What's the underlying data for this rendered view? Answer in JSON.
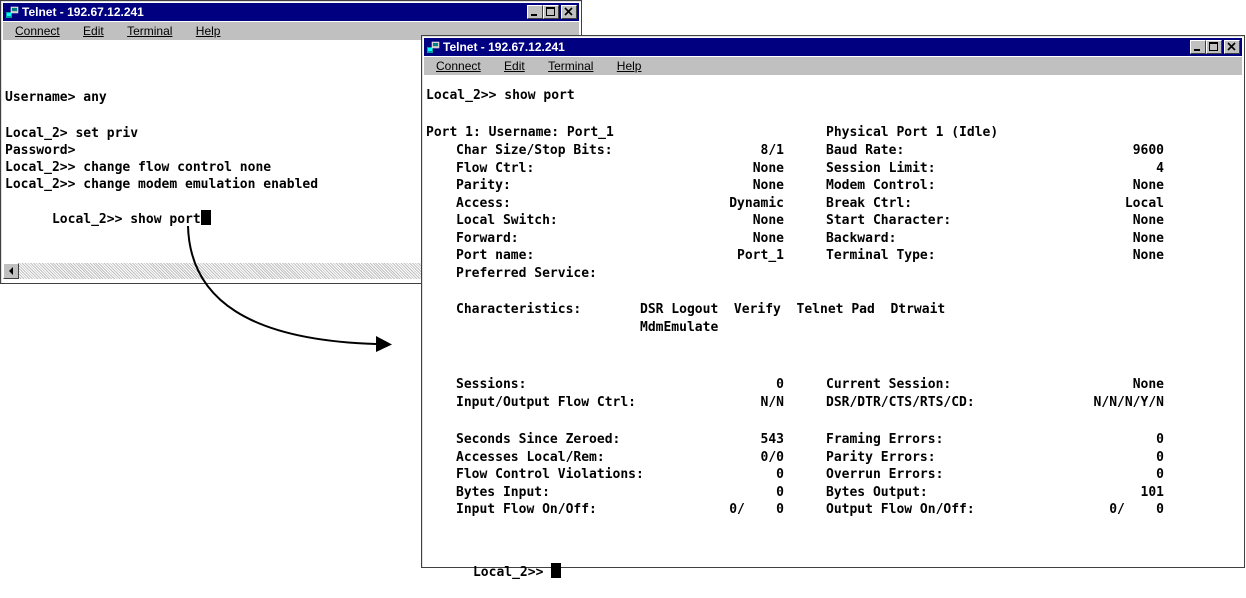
{
  "window1": {
    "title": "Telnet - 192.67.12.241",
    "menu": [
      "Connect",
      "Edit",
      "Terminal",
      "Help"
    ],
    "lines": [
      "",
      "Username> any",
      "",
      "Local_2> set priv",
      "Password>",
      "Local_2>> change flow control none",
      "Local_2>> change modem emulation enabled",
      "Local_2>> show port"
    ]
  },
  "window2": {
    "title": "Telnet - 192.67.12.241",
    "menu": [
      "Connect",
      "Edit",
      "Terminal",
      "Help"
    ],
    "command": "Local_2>> show port",
    "port_header_left": "Port 1: Username: Port_1",
    "port_header_right": "Physical Port 1 (Idle)",
    "block1": [
      {
        "l": "Char Size/Stop Bits:",
        "lv": "8/1",
        "r": "Baud Rate:",
        "rv": "9600"
      },
      {
        "l": "Flow Ctrl:",
        "lv": "None",
        "r": "Session Limit:",
        "rv": "4"
      },
      {
        "l": "Parity:",
        "lv": "None",
        "r": "Modem Control:",
        "rv": "None"
      },
      {
        "l": "Access:",
        "lv": "Dynamic",
        "r": "Break Ctrl:",
        "rv": "Local"
      },
      {
        "l": "Local Switch:",
        "lv": "None",
        "r": "Start Character:",
        "rv": "None"
      },
      {
        "l": "Forward:",
        "lv": "None",
        "r": "Backward:",
        "rv": "None"
      },
      {
        "l": "Port name:",
        "lv": "Port_1",
        "r": "Terminal Type:",
        "rv": "None"
      },
      {
        "l": "Preferred Service:",
        "lv": "",
        "r": "",
        "rv": ""
      }
    ],
    "characteristics_label": "Characteristics:",
    "characteristics_line1": "DSR Logout  Verify  Telnet Pad  Dtrwait",
    "characteristics_line2": "MdmEmulate",
    "block2": [
      {
        "l": "Sessions:",
        "lv": "0",
        "r": "Current Session:",
        "rv": "None"
      },
      {
        "l": "Input/Output Flow Ctrl:",
        "lv": "N/N",
        "r": "DSR/DTR/CTS/RTS/CD:",
        "rv": "N/N/N/Y/N"
      }
    ],
    "block3": [
      {
        "l": "Seconds Since Zeroed:",
        "lv": "543",
        "r": "Framing Errors:",
        "rv": "0"
      },
      {
        "l": "Accesses Local/Rem:",
        "lv": "0/0",
        "r": "Parity Errors:",
        "rv": "0"
      },
      {
        "l": "Flow Control Violations:",
        "lv": "0",
        "r": "Overrun Errors:",
        "rv": "0"
      },
      {
        "l": "Bytes Input:",
        "lv": "0",
        "r": "Bytes Output:",
        "rv": "101"
      },
      {
        "l": "Input Flow On/Off:",
        "lv": "0/    0",
        "r": "Output Flow On/Off:",
        "rv": "0/    0"
      }
    ],
    "prompt": "Local_2>>"
  }
}
